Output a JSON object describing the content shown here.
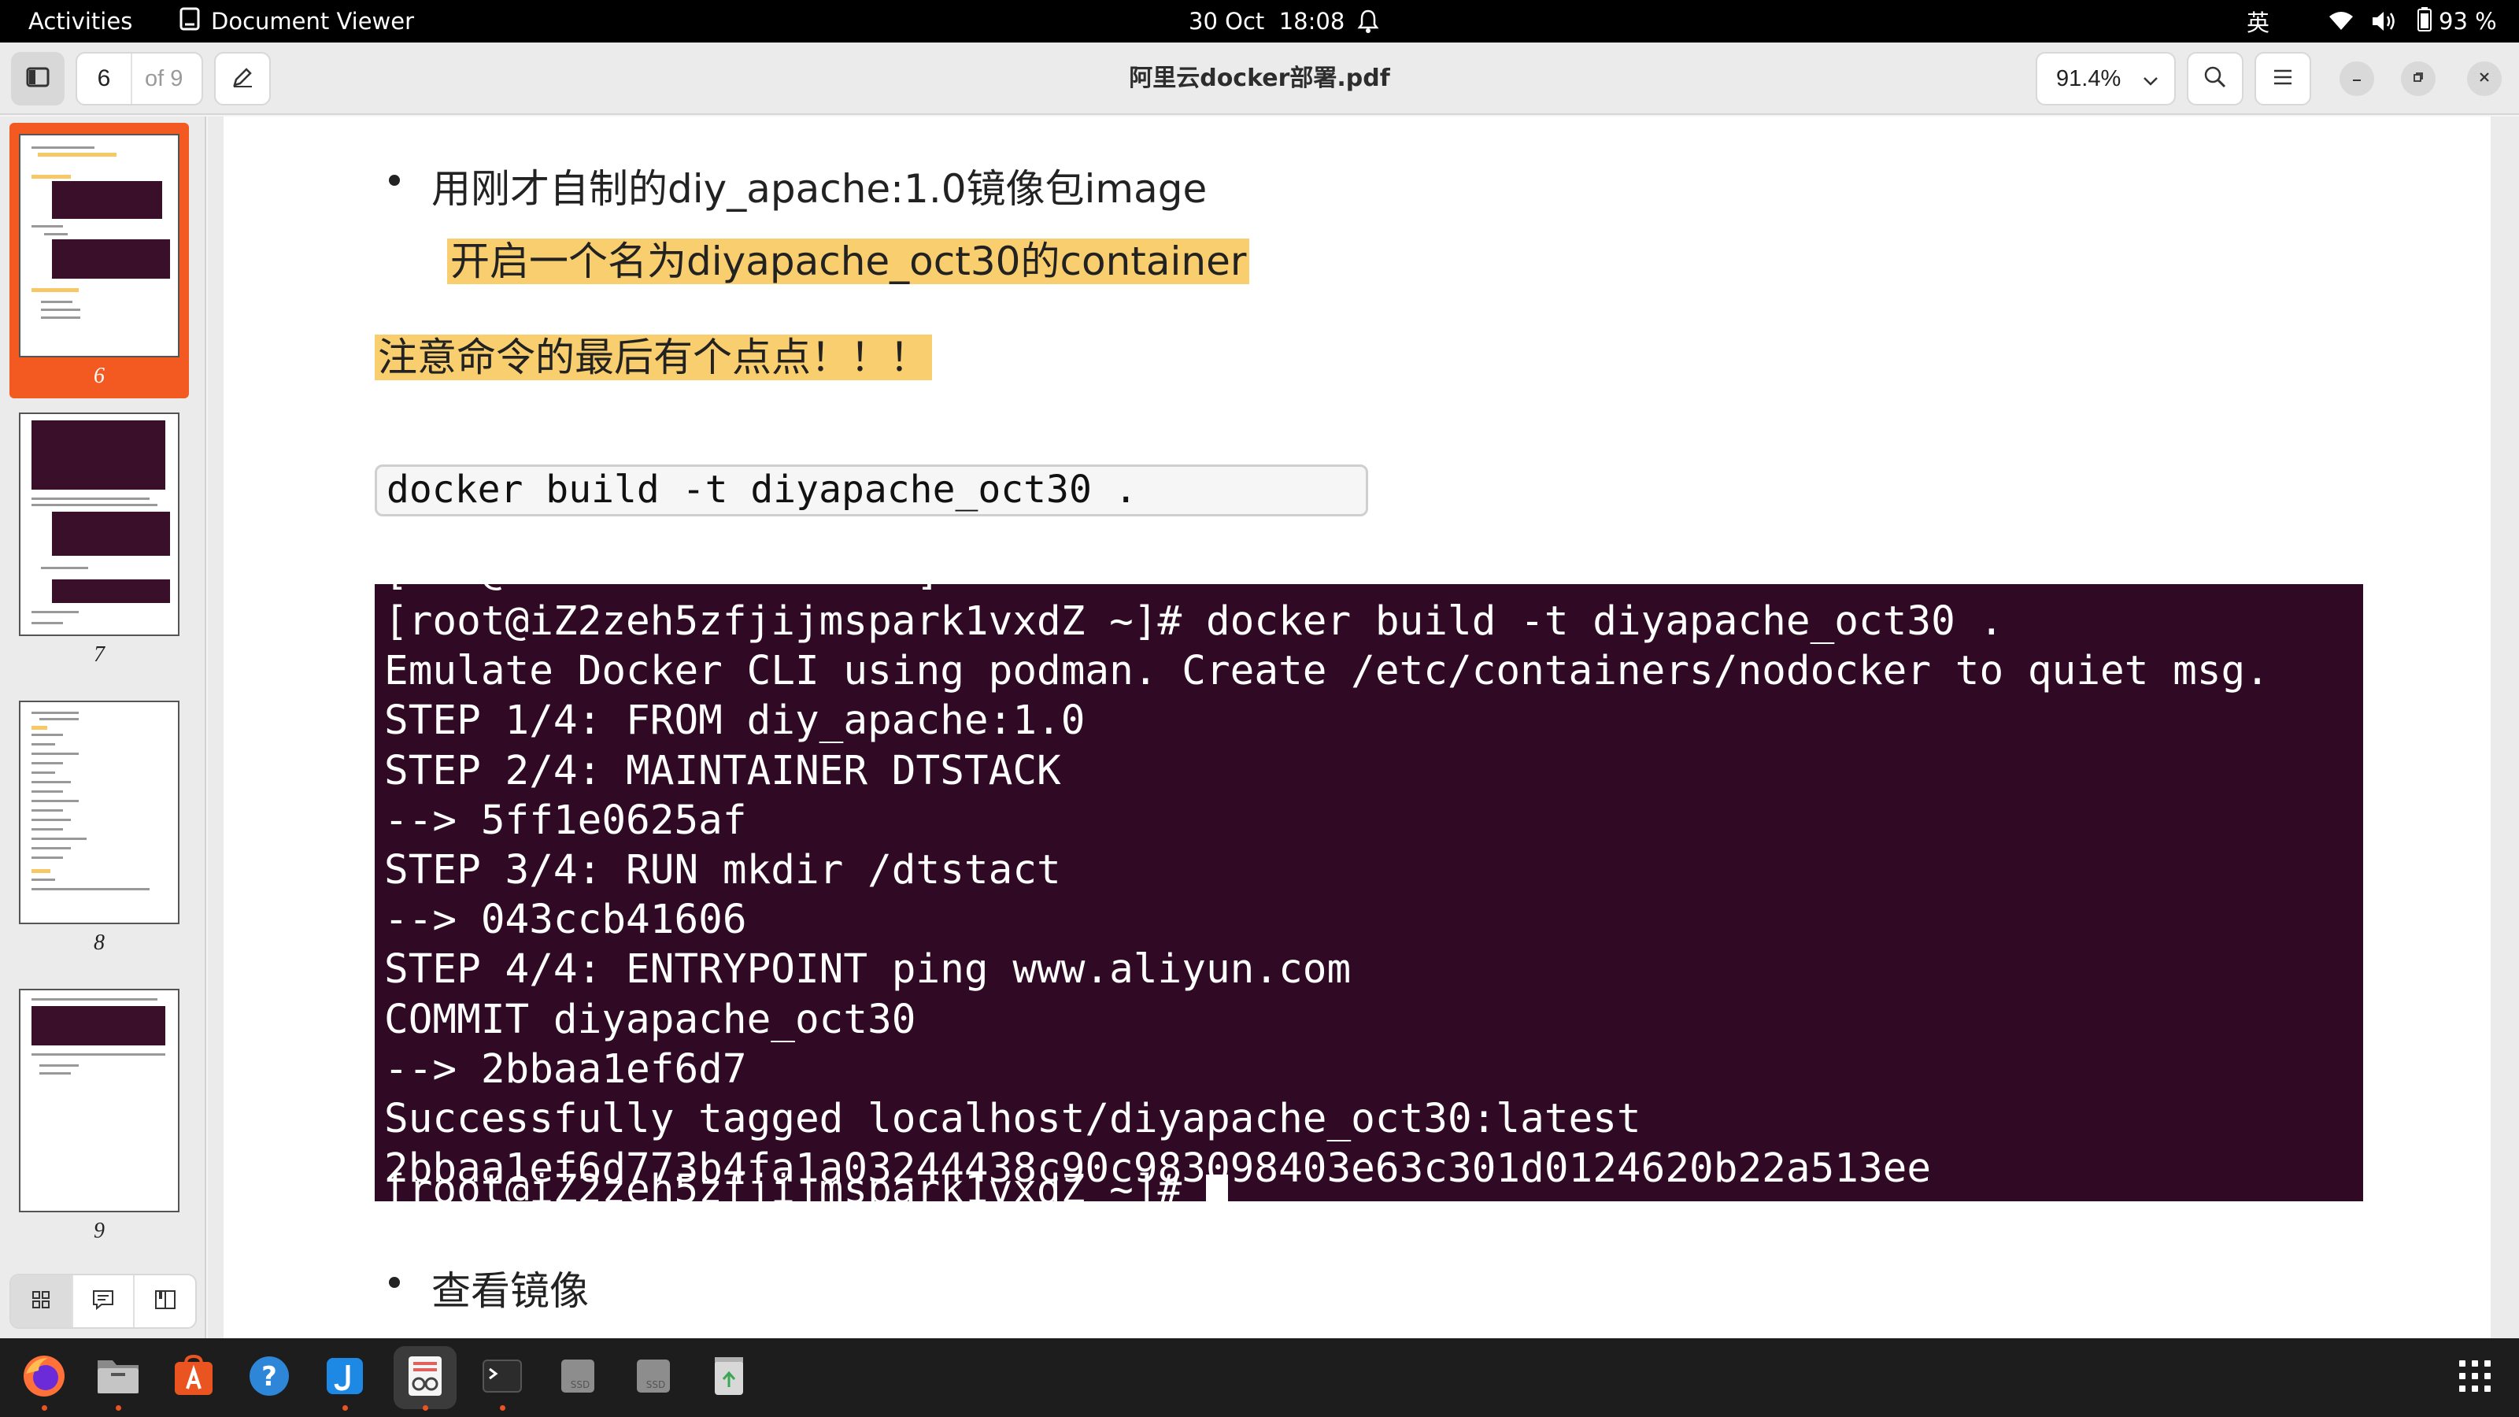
{
  "topbar": {
    "activities": "Activities",
    "app_name": "Document Viewer",
    "date": "30 Oct",
    "time": "18:08",
    "input_method": "英",
    "battery": "93 %"
  },
  "toolbar": {
    "current_page": "6",
    "page_total": "of 9",
    "document_title": "阿里云docker部署.pdf",
    "zoom": "91.4%"
  },
  "sidebar": {
    "thumbnails": [
      {
        "label": "6"
      },
      {
        "label": "7"
      },
      {
        "label": "8"
      },
      {
        "label": "9"
      }
    ]
  },
  "document": {
    "bullet1_line1": "用刚才自制的diy_apache:1.0镜像包image",
    "bullet1_line2": "开启一个名为diyapache_oct30的container",
    "note": "注意命令的最后有个点点！！！",
    "command": "docker build -t diyapache_oct30 .",
    "terminal_cut_top": "[   @                 ]",
    "terminal_lines": [
      "[root@iZ2zeh5zfjijmspark1vxdZ ~]# docker build -t diyapache_oct30 .",
      "Emulate Docker CLI using podman. Create /etc/containers/nodocker to quiet msg.",
      "STEP 1/4: FROM diy_apache:1.0",
      "STEP 2/4: MAINTAINER DTSTACK",
      "--> 5ff1e0625af",
      "STEP 3/4: RUN mkdir /dtstact",
      "--> 043ccb41606",
      "STEP 4/4: ENTRYPOINT ping www.aliyun.com",
      "COMMIT diyapache_oct30",
      "--> 2bbaa1ef6d7",
      "Successfully tagged localhost/diyapache_oct30:latest",
      "2bbaa1ef6d773b4fa1a03244438c90c983098403e63c301d0124620b22a513ee"
    ],
    "terminal_cut_bottom": "[root@iZ2zeh5zfjijmspark1vxdZ ~]# ",
    "bullet2": "查看镜像"
  },
  "dock": {
    "apps": [
      "firefox-icon",
      "files-icon",
      "software-icon",
      "help-icon",
      "jdownloader-icon",
      "document-viewer-icon",
      "terminal-icon",
      "ssd-drive-icon",
      "ssd-drive-icon",
      "trash-icon"
    ]
  },
  "colors": {
    "accent": "#f25a22",
    "terminal_bg": "#300a24",
    "highlight": "#f9ce6e"
  }
}
